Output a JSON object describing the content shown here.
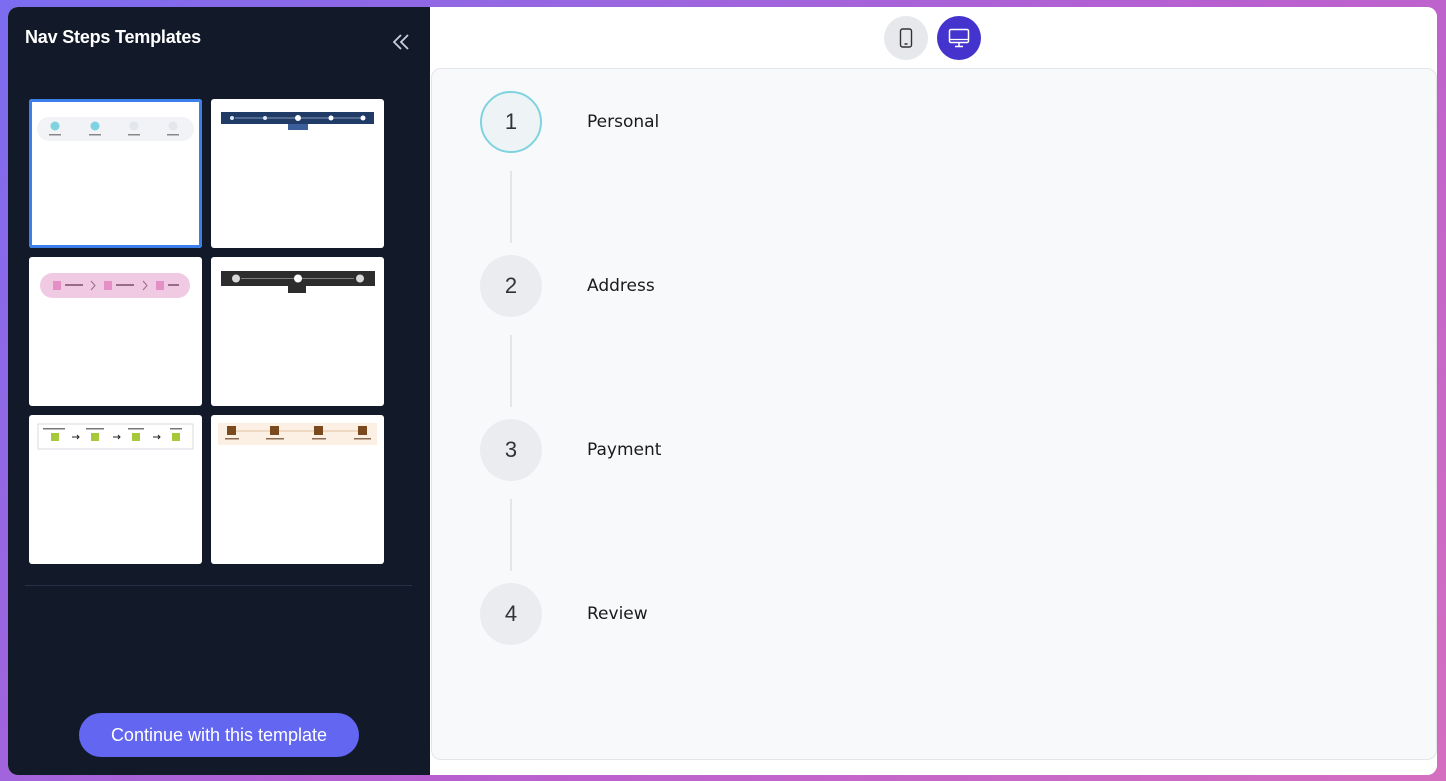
{
  "sidebar": {
    "title": "Nav Steps Templates",
    "collapse_icon": "double-chevron-left-icon",
    "continue_label": "Continue with this template",
    "templates": [
      {
        "id": "template-1",
        "selected": true
      },
      {
        "id": "template-2",
        "selected": false
      },
      {
        "id": "template-3",
        "selected": false
      },
      {
        "id": "template-4",
        "selected": false
      },
      {
        "id": "template-5",
        "selected": false
      },
      {
        "id": "template-6",
        "selected": false
      }
    ]
  },
  "toolbar": {
    "mobile_icon": "mobile-phone-icon",
    "desktop_icon": "desktop-monitor-icon",
    "active_device": "desktop"
  },
  "steps": [
    {
      "number": "1",
      "label": "Personal",
      "active": true
    },
    {
      "number": "2",
      "label": "Address",
      "active": false
    },
    {
      "number": "3",
      "label": "Payment",
      "active": false
    },
    {
      "number": "4",
      "label": "Review",
      "active": false
    }
  ],
  "colors": {
    "sidebar_bg": "#121a2a",
    "accent": "#6366f1",
    "desktop_active": "#4433cc",
    "selected_outline": "#3d7fea",
    "active_step_border": "#7fd3e0"
  }
}
